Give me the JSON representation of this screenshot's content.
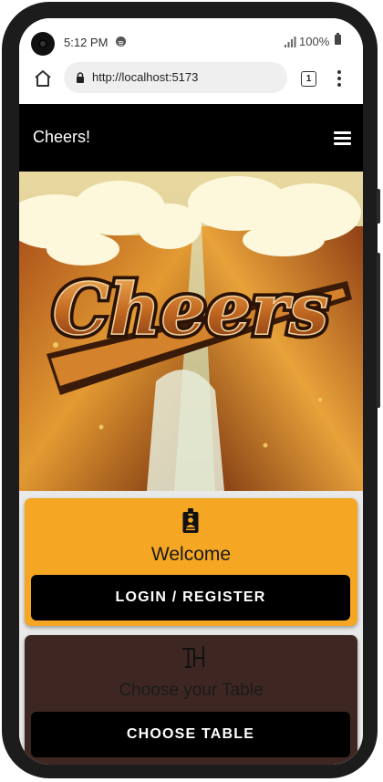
{
  "status_bar": {
    "time": "5:12 PM",
    "battery": "100%"
  },
  "browser": {
    "url": "http://localhost:5173",
    "tab_count": "1"
  },
  "app_bar": {
    "title": "Cheers!"
  },
  "hero": {
    "logo_text": "Cheers"
  },
  "cards": {
    "welcome": {
      "title": "Welcome",
      "button_label": "LOGIN / REGISTER",
      "icon": "badge-icon",
      "color": "#f5a623"
    },
    "table": {
      "title": "Choose your Table",
      "button_label": "CHOOSE TABLE",
      "icon": "table-icon",
      "color": "#3e2723"
    }
  },
  "colors": {
    "app_bar": "#000000",
    "accent": "#f5a623",
    "brown": "#3e2723"
  }
}
